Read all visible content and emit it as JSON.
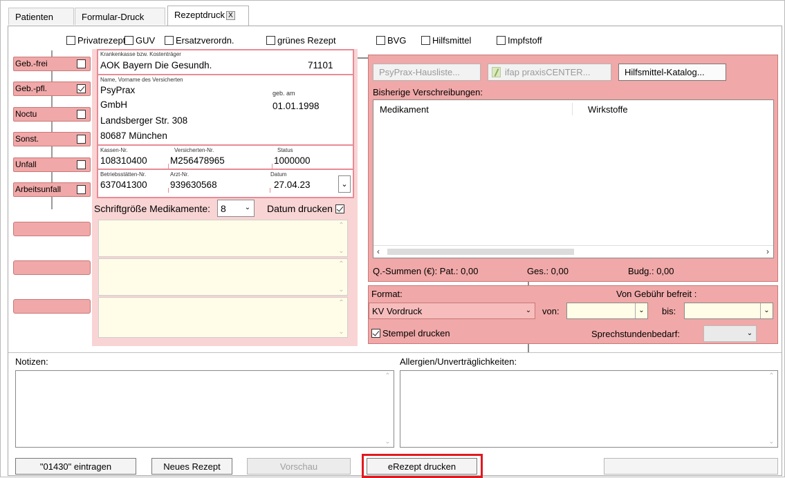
{
  "tabs": [
    {
      "label": "Patienten"
    },
    {
      "label": "Formular-Druck"
    },
    {
      "label": "Rezeptdruck",
      "close": "X"
    }
  ],
  "top_checkboxes": [
    {
      "label": "Privatrezept",
      "checked": false
    },
    {
      "label": "GUV",
      "checked": false
    },
    {
      "label": "Ersatzverordn.",
      "checked": false
    },
    {
      "label": "grünes Rezept",
      "checked": false
    },
    {
      "label": "BVG",
      "checked": false
    },
    {
      "label": "Hilfsmittel",
      "checked": false
    },
    {
      "label": "Impfstoff",
      "checked": false
    }
  ],
  "left_toggles": [
    {
      "label": "Geb.-frei",
      "checked": false
    },
    {
      "label": "Geb.-pfl.",
      "checked": true
    },
    {
      "label": "Noctu",
      "checked": false
    },
    {
      "label": "Sonst.",
      "checked": false
    },
    {
      "label": "Unfall",
      "checked": false
    },
    {
      "label": "Arbeitsunfall",
      "checked": false
    }
  ],
  "form": {
    "kk_label": "Krankenkasse bzw. Kostenträger",
    "kk_value": "AOK Bayern Die Gesundh.",
    "kk_number": "71101",
    "name_label": "Name, Vorname des Versicherten",
    "name_line1": "PsyPrax",
    "name_line2": "GmbH",
    "street": "Landsberger Str. 308",
    "city": "80687 München",
    "dob_label": "geb. am",
    "dob_value": "01.01.1998",
    "kassen_label": "Kassen-Nr.",
    "kassen_value": "108310400",
    "vers_label": "Versicherten-Nr.",
    "vers_value": "M256478965",
    "status_label": "Status",
    "status_value": "1000000",
    "bs_label": "Betriebsstätten-Nr.",
    "bs_value": "637041300",
    "arzt_label": "Arzt-Nr.",
    "arzt_value": "939630568",
    "datum_label": "Datum",
    "datum_value": "27.04.23"
  },
  "font_size": {
    "label": "Schriftgröße Medikamente:",
    "value": "8"
  },
  "datum_drucken": {
    "label": "Datum drucken",
    "checked": true
  },
  "right_panel": {
    "btn_hausliste": "PsyPrax-Hausliste...",
    "btn_ifap": "ifap praxisCENTER...",
    "btn_hilfsmittel": "Hilfsmittel-Katalog...",
    "prev_label": "Bisherige Verschreibungen:",
    "col_medikament": "Medikament",
    "col_wirkstoffe": "Wirkstoffe",
    "sum_pat": "Q.-Summen (€): Pat.: 0,00",
    "sum_ges": "Ges.: 0,00",
    "sum_budg": "Budg.: 0,00"
  },
  "format_panel": {
    "format_label": "Format:",
    "befreit_label": "Von Gebühr befreit :",
    "format_value": "KV Vordruck",
    "von_label": "von:",
    "bis_label": "bis:",
    "stempel_label": "Stempel drucken",
    "stempel_checked": true,
    "sprech_label": "Sprechstundenbedarf:"
  },
  "notes": {
    "label": "Notizen:"
  },
  "allergies": {
    "label": "Allergien/Unverträglichkeiten:"
  },
  "bottom_buttons": {
    "btn_01430": "\"01430\" eintragen",
    "btn_neues": "Neues Rezept",
    "btn_vorschau": "Vorschau",
    "btn_erezept": "eRezept drucken"
  },
  "colors": {
    "accent_pink": "#f0a8a8",
    "highlight_red": "#e0181f",
    "memo_yellow": "#fffde8"
  }
}
